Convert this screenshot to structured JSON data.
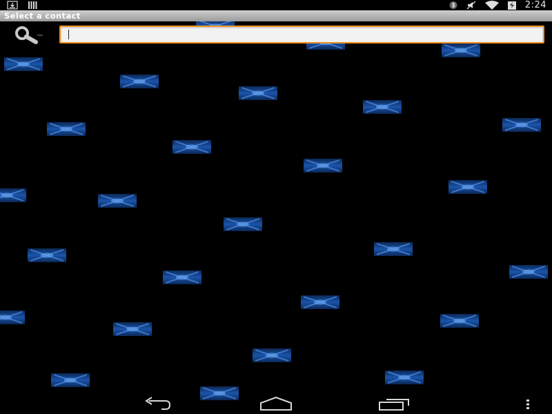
{
  "status_bar": {
    "clock": "2:24",
    "icons": [
      "download-icon",
      "barcode-icon",
      "bluetooth-icon",
      "silent-mode-icon",
      "wifi-icon",
      "battery-charging-icon"
    ]
  },
  "title_bar": {
    "title": "Select a contact"
  },
  "search": {
    "value": "",
    "placeholder": "",
    "icon": "search-icon"
  },
  "nav_bar": {
    "buttons": [
      "back-icon",
      "home-icon",
      "recent-apps-icon",
      "menu-icon"
    ]
  },
  "colors": {
    "background": "#000000",
    "accent_focus": "#f09320",
    "wallpaper_mark": "#1f63c8",
    "title_bar_top": "#cfcfcf",
    "title_bar_bottom": "#9b9b9b"
  }
}
